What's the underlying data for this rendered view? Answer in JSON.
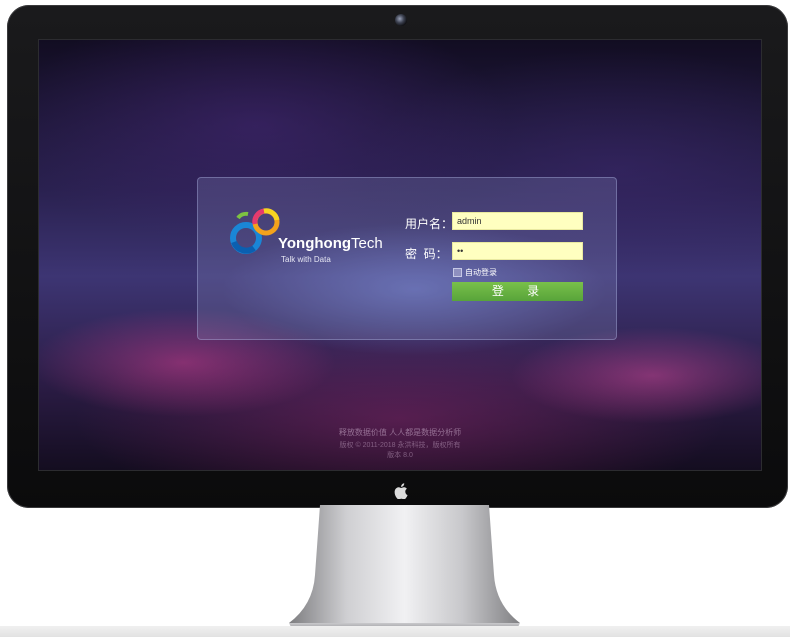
{
  "login": {
    "brand_bold": "Yonghong",
    "brand_light": "Tech",
    "tagline": "Talk with Data",
    "username_label": "用户名：",
    "username_value": "admin",
    "password_label": "密  码：",
    "password_value": "••",
    "remember_label": "自动登录",
    "login_button_label": "登 录"
  },
  "footer": {
    "slogan": "释放数据价值 人人都是数据分析师",
    "copyright": "版权 © 2011-2018 永洪科技，版权所有",
    "version": "版本 8.0"
  },
  "colors": {
    "login_button": "#5aa83b",
    "input_background": "#ffffc0"
  },
  "icons": {
    "logo": "yonghong-rings-logo",
    "device": "apple-logo-icon",
    "camera": "camera-icon"
  }
}
